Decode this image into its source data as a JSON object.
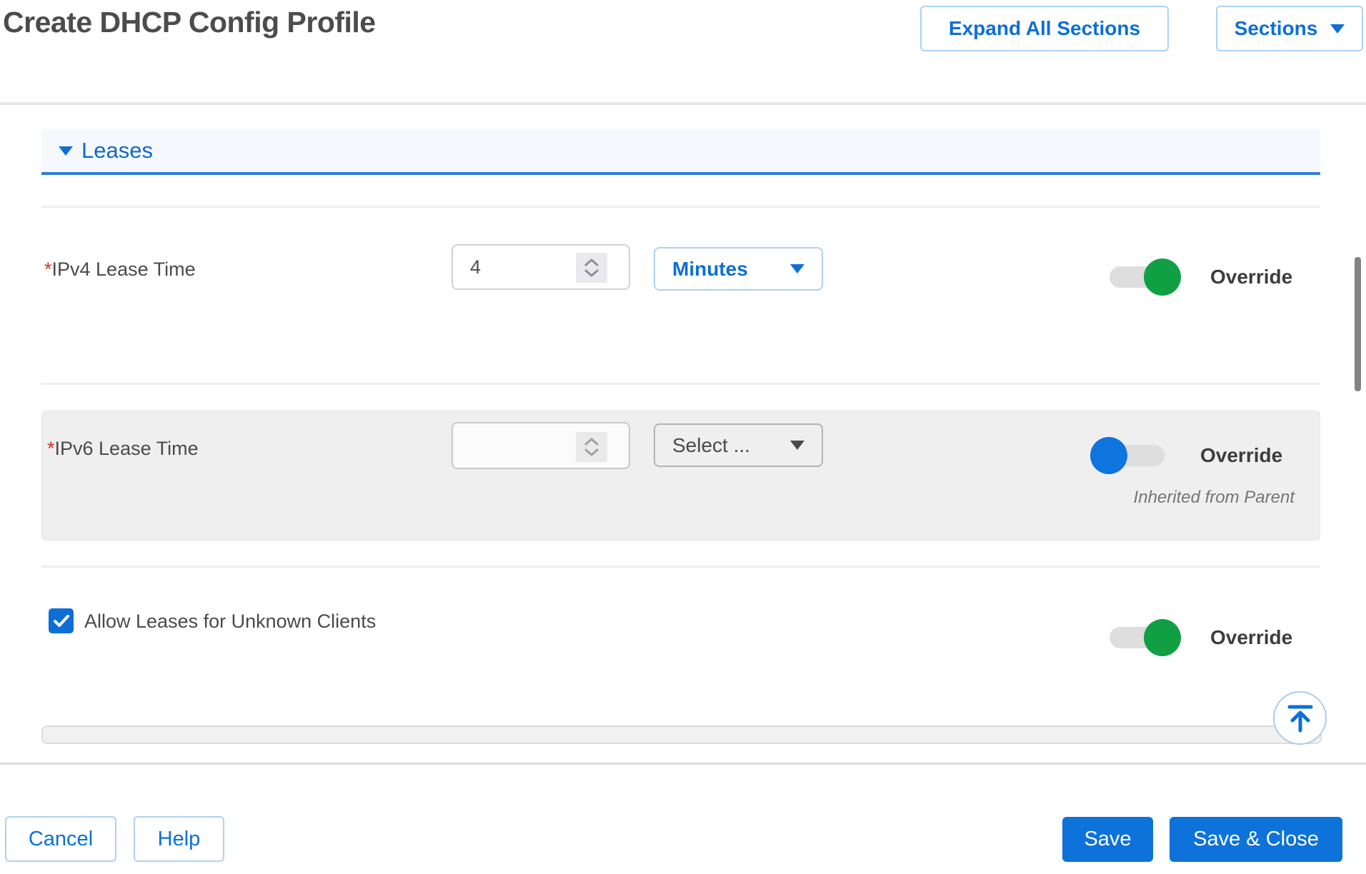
{
  "header": {
    "title": "Create DHCP Config Profile",
    "expand_all_label": "Expand All Sections",
    "sections_label": "Sections"
  },
  "section": {
    "title": "Leases"
  },
  "rows": {
    "ipv4": {
      "required_marker": "*",
      "label": "IPv4 Lease Time",
      "value": "4",
      "unit": "Minutes",
      "override_label": "Override",
      "override_state": "on"
    },
    "ipv6": {
      "required_marker": "*",
      "label": "IPv6 Lease Time",
      "value": "",
      "unit_placeholder": "Select ...",
      "override_label": "Override",
      "override_state": "off",
      "inherited_note": "Inherited from Parent"
    },
    "unknown_clients": {
      "label": "Allow Leases for Unknown Clients",
      "checked": "true",
      "override_label": "Override",
      "override_state": "on"
    }
  },
  "footer": {
    "cancel_label": "Cancel",
    "help_label": "Help",
    "save_label": "Save",
    "save_close_label": "Save & Close"
  },
  "colors": {
    "primary_blue": "#0d6fd6",
    "light_blue_border": "#aed2f3",
    "green_on": "#119f44",
    "toggle_off_blue": "#0e74de",
    "toggle_track": "#dedede",
    "label_text": "#4a4a4a",
    "required_red": "#d0342c",
    "row_gray_bg": "#efefef",
    "inherited_text": "#757575",
    "save_fill": "#0d72da"
  }
}
